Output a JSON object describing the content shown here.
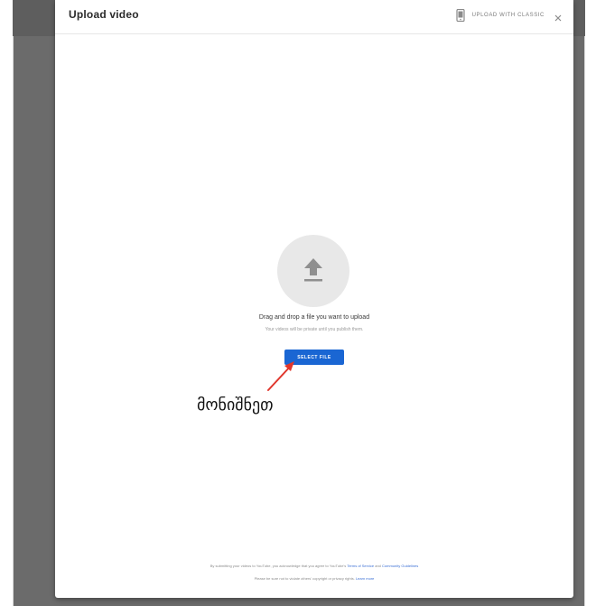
{
  "dialog": {
    "title": "Upload video",
    "header_link": "UPLOAD WITH CLASSIC",
    "phone_icon": "phone-icon",
    "close_icon": "close-icon"
  },
  "dropzone": {
    "upload_icon": "upload-arrow-icon",
    "primary_text": "Drag and drop a file you want to upload",
    "secondary_text": "Your videos will be private until you publish them.",
    "button_label": "SELECT FILE"
  },
  "annotation": {
    "text": "მონიშნეთ",
    "arrow_color": "#e0362c"
  },
  "footer": {
    "line1_prefix": "By submitting your videos to YouTube, you acknowledge that you agree to YouTube's",
    "terms_link": "Terms of Service",
    "and": "and",
    "guidelines_link": "Community Guidelines",
    "line2_prefix": "Please be sure not to violate others' copyright or privacy rights.",
    "learn_more_link": "Learn more"
  },
  "colors": {
    "primary_button": "#1a66d3",
    "link": "#3b6fd4",
    "backdrop": "#6b6b6b"
  }
}
